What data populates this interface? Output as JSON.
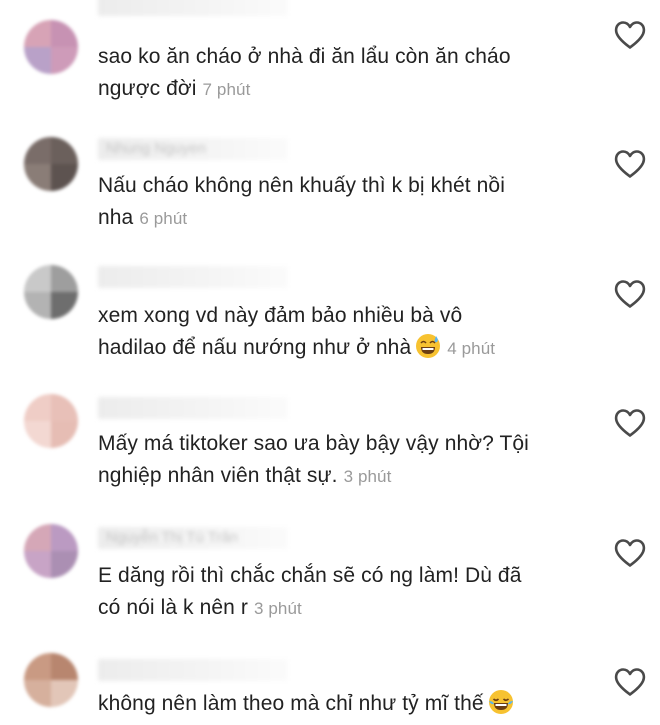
{
  "comments": [
    {
      "username": "",
      "line1": "sao ko ăn cháo ở nhà đi ăn lẩu còn ăn cháo",
      "line2": "ngược đời",
      "time": "7 phút",
      "emoji": "",
      "avatar_colors": [
        "#d7a3b6",
        "#c792b3",
        "#b9a1c8",
        "#ce9bb9"
      ]
    },
    {
      "username": "Nhung Nguyen",
      "line1": "Nấu cháo không nên khuấy thì k bị khét nồi",
      "line2": "nha",
      "time": "6 phút",
      "emoji": "",
      "avatar_colors": [
        "#7a6d69",
        "#6b605c",
        "#8a7d77",
        "#5d5350"
      ]
    },
    {
      "username": "",
      "line1": "xem xong vd này đảm bảo nhiều bà vô",
      "line2": "hadilao để nấu nướng như ở nhà",
      "time": "4 phút",
      "emoji": "grinning-sweat-emoji",
      "avatar_colors": [
        "#c9c9c9",
        "#9e9e9e",
        "#b3b3b3",
        "#6e6e6e"
      ]
    },
    {
      "username": "",
      "line1": "Mấy má tiktoker sao ưa bày bậy vậy nhờ? Tội",
      "line2": "nghiệp nhân viên thật sự.",
      "time": "3 phút",
      "emoji": "",
      "avatar_colors": [
        "#efcdc6",
        "#e8c0b8",
        "#f3d8d2",
        "#e6bdb4"
      ]
    },
    {
      "username": "Nguyễn Thị Tú Trân",
      "line1": "E dăng rồi thì chắc chắn sẽ có ng làm! Dù đã",
      "line2": "có nói là k nên r",
      "time": "3 phút",
      "emoji": "",
      "avatar_colors": [
        "#d5a7b7",
        "#bb9ac2",
        "#c8a4c6",
        "#ab8fb3"
      ]
    },
    {
      "username": "",
      "line1": "không nên làm theo mà chỉ như tỷ mĩ thế",
      "line2": "",
      "time": "",
      "emoji": "joy-emoji",
      "avatar_colors": [
        "#c99a83",
        "#b8866f",
        "#d6b09d",
        "#e2c6b8"
      ]
    }
  ],
  "icons": {
    "like": "heart-outline-icon"
  },
  "colors": {
    "text": "#222222",
    "time": "#9a9a9a",
    "heart": "#4a4a4a"
  }
}
